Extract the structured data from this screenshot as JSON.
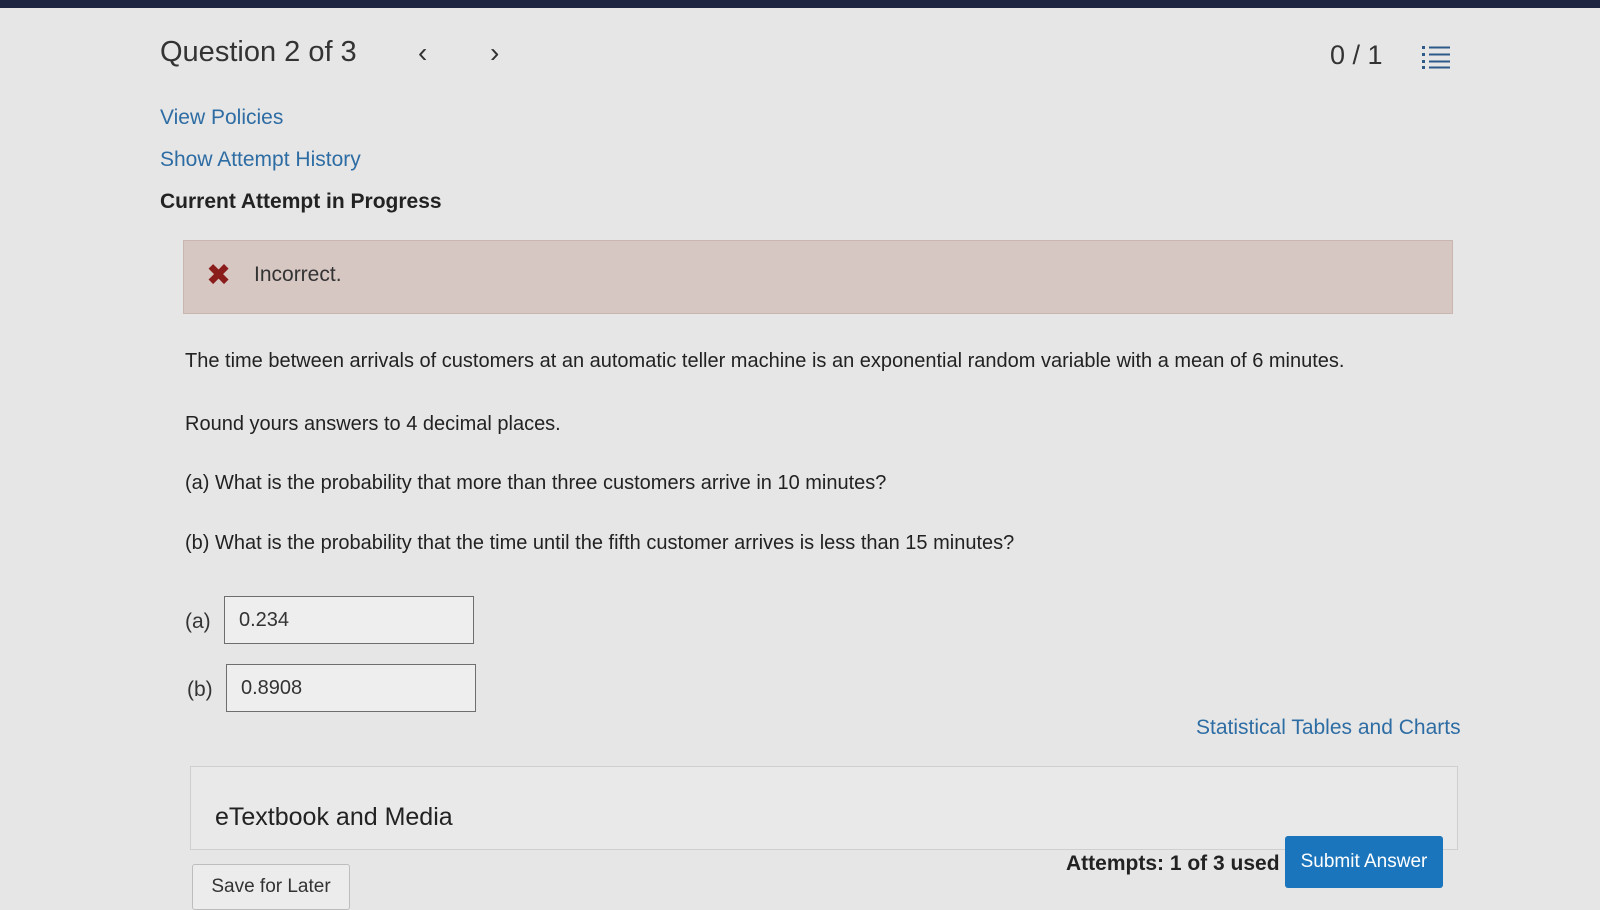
{
  "header": {
    "question_label": "Question 2 of 3",
    "prev_icon": "chevron-left-icon",
    "next_icon": "chevron-right-icon",
    "score": "0 / 1",
    "menu_icon": "list-icon"
  },
  "links": {
    "view_policies": "View Policies",
    "show_attempt_history": "Show Attempt History",
    "statistical_tables": "Statistical Tables and Charts"
  },
  "attempt_heading": "Current Attempt in Progress",
  "feedback": {
    "icon": "x-mark-icon",
    "text": "Incorrect.",
    "background": "#d7c7c3",
    "icon_color": "#8b1c1c"
  },
  "question": {
    "stem": "The time between arrivals of customers at an automatic teller machine is an exponential random variable with a mean of 6 minutes.",
    "instruction": "Round yours answers to 4 decimal places.",
    "part_a": "(a) What is the probability that more than three customers arrive in 10 minutes?",
    "part_b": "(b) What is the probability that the time until the fifth customer arrives is less than 15 minutes?"
  },
  "answers": {
    "a": {
      "label": "(a)",
      "value": "0.234"
    },
    "b": {
      "label": "(b)",
      "value": "0.8908"
    }
  },
  "etextbook": {
    "label": "eTextbook and Media"
  },
  "footer": {
    "attempts": "Attempts: 1 of 3 used",
    "submit_label": "Submit Answer",
    "save_label": "Save for Later",
    "accent": "#1b75bc"
  }
}
